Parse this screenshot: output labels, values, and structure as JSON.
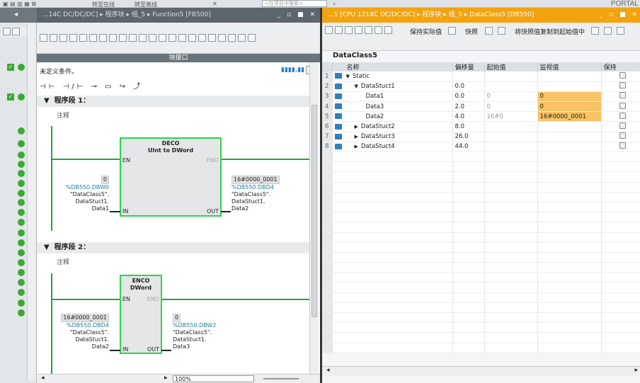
{
  "topbar": {
    "btn1": "转至在线",
    "btn2": "转至离线",
    "search_placeholder": "<在项目中搜索>",
    "portal": "PORTAL"
  },
  "left": {
    "title": "...14C DC/DC/DC] ▸ 程序块 ▸ 组_5 ▸ Function5 [FB500]",
    "interface_header": "块接口",
    "condition": "未定义条件。",
    "seg1": {
      "title": "程序段 1：",
      "comment": "注释",
      "box_name": "DECO",
      "box_sub": "UInt  to  DWord",
      "en": "EN",
      "eno": "ENO",
      "in": "IN",
      "out": "OUT",
      "in_val": "0",
      "in_addr": "%DB550.DBW0",
      "in_sym1": "\"DataClass5\".",
      "in_sym2": "DataStuct1.",
      "in_sym3": "Data1",
      "out_val": "16#0000_0001",
      "out_addr": "%DB550.DBD4",
      "out_sym1": "\"DataClass5\".",
      "out_sym2": "DataStuct1.",
      "out_sym3": "Data2"
    },
    "seg2": {
      "title": "程序段 2：",
      "comment": "注释",
      "box_name": "ENCO",
      "box_sub": "DWord",
      "en": "EN",
      "eno": "ENO",
      "in": "IN",
      "out": "OUT",
      "in_val": "16#0000_0001",
      "in_addr": "%DB550.DBD4",
      "in_sym1": "\"DataClass5\".",
      "in_sym2": "DataStuct1.",
      "in_sym3": "Data2",
      "out_val": "0",
      "out_addr": "%DB550.DBW2",
      "out_sym1": "\"DataClass5\".",
      "out_sym2": "DataStuct1.",
      "out_sym3": "Data3"
    },
    "zoom": "100%"
  },
  "right": {
    "title": "...1 [CPU 1214C DC/DC/DC] ▸ 程序块 ▸ 组_5 ▸ DataClass5 [DB550]",
    "tb_keep": "保持实际值",
    "tb_snap": "快照",
    "tb_copy": "将快照值复制到起始值中",
    "db_name": "DataClass5",
    "headers": [
      "名称",
      "偏移量",
      "起始值",
      "监视值",
      "保持"
    ],
    "rows": [
      {
        "n": "1",
        "indent": 0,
        "exp": "▼",
        "name": "Static",
        "offset": "",
        "start": "",
        "monitor": "",
        "hl": false
      },
      {
        "n": "2",
        "indent": 1,
        "exp": "▼",
        "name": "DataStuct1",
        "offset": "0.0",
        "start": "",
        "monitor": "",
        "hl": false
      },
      {
        "n": "3",
        "indent": 2,
        "exp": "",
        "name": "Data1",
        "offset": "0.0",
        "start": "0",
        "monitor": "0",
        "hl": true
      },
      {
        "n": "4",
        "indent": 2,
        "exp": "",
        "name": "Data3",
        "offset": "2.0",
        "start": "0",
        "monitor": "0",
        "hl": true
      },
      {
        "n": "5",
        "indent": 2,
        "exp": "",
        "name": "Data2",
        "offset": "4.0",
        "start": "16#0",
        "monitor": "16#0000_0001",
        "hl": true
      },
      {
        "n": "6",
        "indent": 1,
        "exp": "▶",
        "name": "DataStuct2",
        "offset": "8.0",
        "start": "",
        "monitor": "",
        "hl": false
      },
      {
        "n": "7",
        "indent": 1,
        "exp": "▶",
        "name": "DataStuct3",
        "offset": "26.0",
        "start": "",
        "monitor": "",
        "hl": false
      },
      {
        "n": "8",
        "indent": 1,
        "exp": "▶",
        "name": "DataStuct4",
        "offset": "44.0",
        "start": "",
        "monitor": "",
        "hl": false
      }
    ]
  }
}
